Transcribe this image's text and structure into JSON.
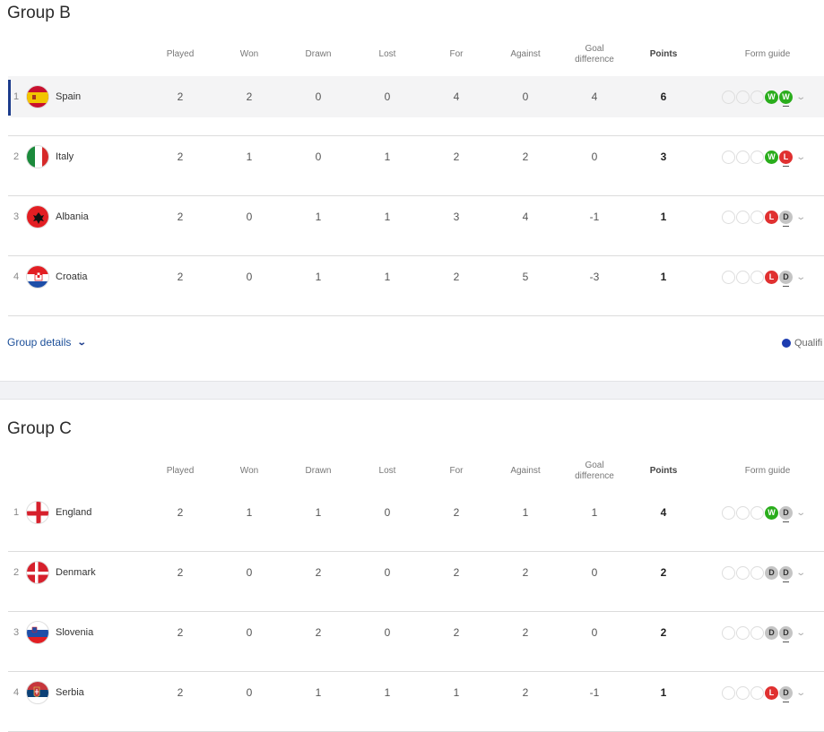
{
  "columns": [
    {
      "key": "played",
      "label": "Played",
      "bold": false
    },
    {
      "key": "won",
      "label": "Won",
      "bold": false
    },
    {
      "key": "drawn",
      "label": "Drawn",
      "bold": false
    },
    {
      "key": "lost",
      "label": "Lost",
      "bold": false
    },
    {
      "key": "for",
      "label": "For",
      "bold": false
    },
    {
      "key": "against",
      "label": "Against",
      "bold": false
    },
    {
      "key": "gd",
      "label": "Goal\ndifference",
      "bold": false
    },
    {
      "key": "points",
      "label": "Points",
      "bold": true
    },
    {
      "key": "form",
      "label": "Form guide",
      "bold": false
    }
  ],
  "groups": [
    {
      "title": "Group B",
      "details_label": "Group details",
      "legend_label": "Qualifi",
      "legend_color": "#1c3cb0",
      "teams": [
        {
          "pos": "1",
          "name": "Spain",
          "flag": "spain",
          "played": "2",
          "won": "2",
          "drawn": "0",
          "lost": "0",
          "for": "4",
          "against": "0",
          "gd": "4",
          "points": "6",
          "form": [
            "",
            "",
            "",
            "W",
            "W"
          ],
          "highlight": true
        },
        {
          "pos": "2",
          "name": "Italy",
          "flag": "italy",
          "played": "2",
          "won": "1",
          "drawn": "0",
          "lost": "1",
          "for": "2",
          "against": "2",
          "gd": "0",
          "points": "3",
          "form": [
            "",
            "",
            "",
            "W",
            "L"
          ]
        },
        {
          "pos": "3",
          "name": "Albania",
          "flag": "albania",
          "played": "2",
          "won": "0",
          "drawn": "1",
          "lost": "1",
          "for": "3",
          "against": "4",
          "gd": "-1",
          "points": "1",
          "form": [
            "",
            "",
            "",
            "L",
            "D"
          ]
        },
        {
          "pos": "4",
          "name": "Croatia",
          "flag": "croatia",
          "played": "2",
          "won": "0",
          "drawn": "1",
          "lost": "1",
          "for": "2",
          "against": "5",
          "gd": "-3",
          "points": "1",
          "form": [
            "",
            "",
            "",
            "L",
            "D"
          ]
        }
      ]
    },
    {
      "title": "Group C",
      "teams": [
        {
          "pos": "1",
          "name": "England",
          "flag": "england",
          "played": "2",
          "won": "1",
          "drawn": "1",
          "lost": "0",
          "for": "2",
          "against": "1",
          "gd": "1",
          "points": "4",
          "form": [
            "",
            "",
            "",
            "W",
            "D"
          ]
        },
        {
          "pos": "2",
          "name": "Denmark",
          "flag": "denmark",
          "played": "2",
          "won": "0",
          "drawn": "2",
          "lost": "0",
          "for": "2",
          "against": "2",
          "gd": "0",
          "points": "2",
          "form": [
            "",
            "",
            "",
            "D",
            "D"
          ]
        },
        {
          "pos": "3",
          "name": "Slovenia",
          "flag": "slovenia",
          "played": "2",
          "won": "0",
          "drawn": "2",
          "lost": "0",
          "for": "2",
          "against": "2",
          "gd": "0",
          "points": "2",
          "form": [
            "",
            "",
            "",
            "D",
            "D"
          ]
        },
        {
          "pos": "4",
          "name": "Serbia",
          "flag": "serbia",
          "played": "2",
          "won": "0",
          "drawn": "1",
          "lost": "1",
          "for": "1",
          "against": "2",
          "gd": "-1",
          "points": "1",
          "form": [
            "",
            "",
            "",
            "L",
            "D"
          ]
        }
      ]
    }
  ],
  "colors": {
    "win": "#2aad1c",
    "loss": "#e03131",
    "draw": "#c4c4c4",
    "accent": "#1c3c8c",
    "link": "#1c4f99"
  }
}
